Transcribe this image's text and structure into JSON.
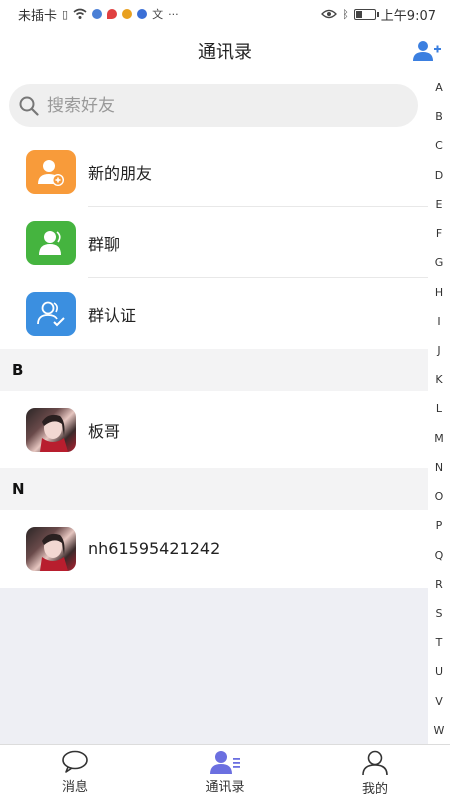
{
  "status_bar": {
    "carrier": "未插卡",
    "time": "上午9:07",
    "battery_level": 0.3
  },
  "header": {
    "title": "通讯录"
  },
  "search": {
    "placeholder": "搜索好友"
  },
  "functions": [
    {
      "label": "新的朋友",
      "icon": "new-friend-icon",
      "color": "#f89b3a"
    },
    {
      "label": "群聊",
      "icon": "group-chat-icon",
      "color": "#45b43f"
    },
    {
      "label": "群认证",
      "icon": "group-verify-icon",
      "color": "#3b8fe0"
    }
  ],
  "sections": [
    {
      "letter": "B",
      "contacts": [
        {
          "name": "板哥"
        }
      ]
    },
    {
      "letter": "N",
      "contacts": [
        {
          "name": "nh61595421242"
        }
      ]
    }
  ],
  "alphabet": [
    "A",
    "B",
    "C",
    "D",
    "E",
    "F",
    "G",
    "H",
    "I",
    "J",
    "K",
    "L",
    "M",
    "N",
    "O",
    "P",
    "Q",
    "R",
    "S",
    "T",
    "U",
    "V",
    "W"
  ],
  "tabs": [
    {
      "label": "消息",
      "icon": "chat-bubble-icon",
      "active": false
    },
    {
      "label": "通讯录",
      "icon": "contacts-icon",
      "active": true
    },
    {
      "label": "我的",
      "icon": "person-icon",
      "active": false
    }
  ],
  "colors": {
    "accent": "#3b7fe0",
    "tab_active": "#6b6fe0"
  }
}
